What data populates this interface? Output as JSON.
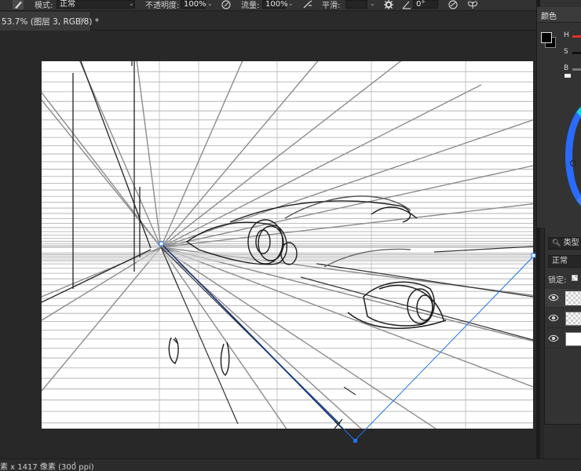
{
  "options_bar": {
    "mode_label": "模式:",
    "mode_value": "正常",
    "opacity_label": "不透明度:",
    "opacity_value": "100%",
    "flow_label": "流量:",
    "flow_value": "100%",
    "smoothing_label": "平滑:",
    "angle_value": "0°"
  },
  "document_tab": {
    "title": "53.7% (图层 3, RGB/8) *",
    "close_glyph": "×"
  },
  "color_panel": {
    "tab_label": "颜色",
    "h_label": "H",
    "s_label": "S",
    "b_label": "B",
    "foreground": "#000000",
    "background": "#000000"
  },
  "layers_panel": {
    "filter_label": "类型",
    "blend_mode": "正常",
    "lock_label": "锁定:",
    "layers": [
      {
        "thumb": "transparent"
      },
      {
        "thumb": "transparent"
      },
      {
        "thumb": "white"
      }
    ]
  },
  "status_bar": {
    "doc_info": "素 x 1417 像素 (300 ppi)",
    "arrow_glyph": "›"
  },
  "colors": {
    "ui_dark": "#323232",
    "canvas": "#ffffff",
    "path_blue": "#1e73e8",
    "accent_red": "#e0302a"
  }
}
